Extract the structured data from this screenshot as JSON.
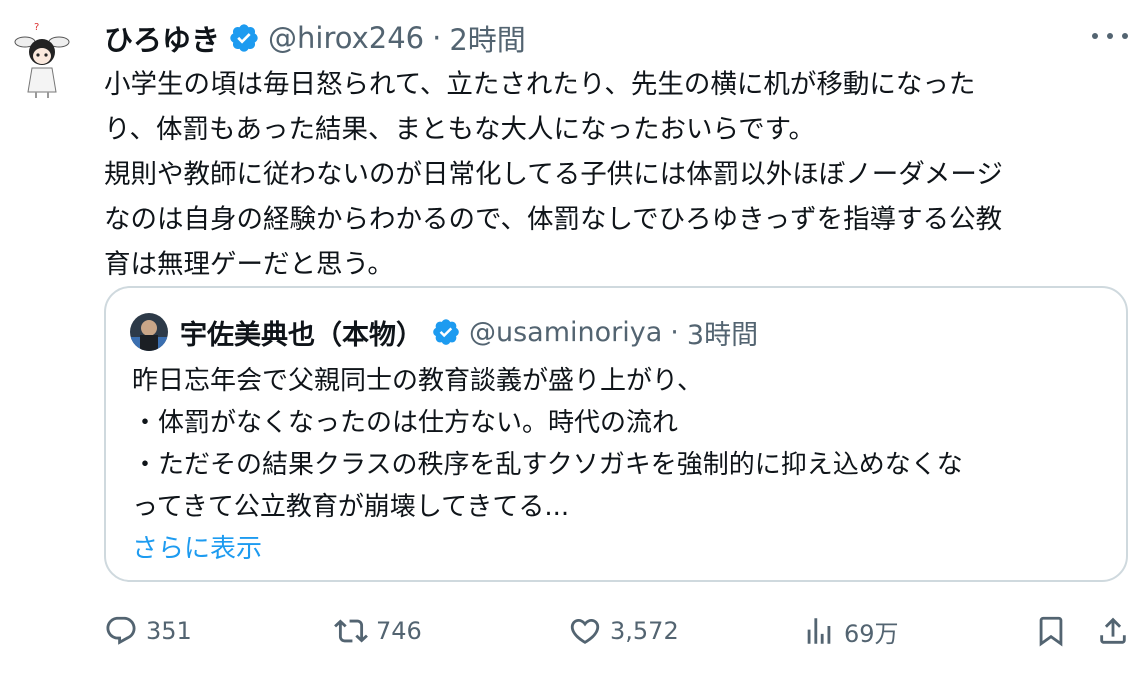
{
  "tweet": {
    "author_name": "ひろゆき",
    "handle": "@hirox246",
    "separator": "·",
    "time": "2時間",
    "lines": [
      "小学生の頃は毎日怒られて、立たされたり、先生の横に机が移動になった",
      "り、体罰もあった結果、まともな大人になったおいらです。",
      "規則や教師に従わないのが日常化してる子供には体罰以外ほぼノーダメージ",
      "なのは自身の経験からわかるので、体罰なしでひろゆきっずを指導する公教",
      "育は無理ゲーだと思う。"
    ]
  },
  "quote": {
    "author_name": "宇佐美典也（本物）",
    "handle": "@usaminoriya",
    "separator": "·",
    "time": "3時間",
    "lines": [
      "昨日忘年会で父親同士の教育談義が盛り上がり、",
      "・体罰がなくなったのは仕方ない。時代の流れ",
      "・ただその結果クラスの秩序を乱すクソガキを強制的に抑え込めなくな",
      "ってきて公立教育が崩壊してきてる..."
    ],
    "show_more": "さらに表示"
  },
  "actions": {
    "reply_count": "351",
    "retweet_count": "746",
    "like_count": "3,572",
    "views_count": "69万"
  },
  "icons": {
    "verified": "verified-badge-icon",
    "more": "more-icon",
    "reply": "reply-icon",
    "retweet": "retweet-icon",
    "like": "heart-icon",
    "views": "views-icon",
    "bookmark": "bookmark-icon",
    "share": "share-icon"
  },
  "colors": {
    "accent": "#1d9bf0",
    "secondary_text": "#536471",
    "border": "#cfd9de"
  }
}
